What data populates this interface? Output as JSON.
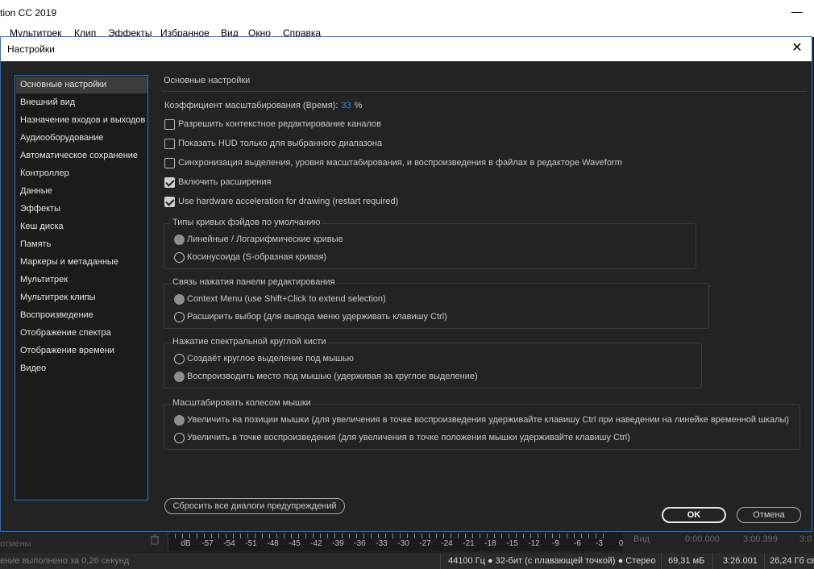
{
  "app": {
    "title": "tion CC 2019",
    "minimize_glyph": "—",
    "menu": [
      "Мультитрек",
      "Клип",
      "Эффекты",
      "Избранное",
      "Вид",
      "Окно",
      "Справка"
    ]
  },
  "dialog": {
    "title": "Настройки",
    "close_glyph": "✕",
    "sidebar": [
      "Основные настройки",
      "Внешний вид",
      "Назначение входов и выходов",
      "Аудиооборудование",
      "Автоматическое сохранение",
      "Контроллер",
      "Данные",
      "Эффекты",
      "Кеш диска",
      "Память",
      "Маркеры и метаданные",
      "Мультитрек",
      "Мультитрек клипы",
      "Воспроизведение",
      "Отображение спектра",
      "Отображение времени",
      "Видео"
    ],
    "active_sidebar_index": 0,
    "section_title": "Основные настройки",
    "zoom_label": "Коэффициент масштабирования (Время):",
    "zoom_value": "33",
    "zoom_unit": "%",
    "checkboxes": [
      {
        "label": "Разрешить контекстное редактирование каналов",
        "checked": false
      },
      {
        "label": "Показать HUD только для выбранного диапазона",
        "checked": false
      },
      {
        "label": "Синхронизация выделения, уровня масштабирования, и воспроизведения в файлах в редакторе Waveform",
        "checked": false
      },
      {
        "label": "Включить расширения",
        "checked": true
      },
      {
        "label": "Use hardware acceleration for drawing (restart required)",
        "checked": true
      }
    ],
    "groups": [
      {
        "title": "Типы кривых фэйдов по умолчанию",
        "options": [
          {
            "label": "Линейные / Логарифмические кривые",
            "selected": true
          },
          {
            "label": "Косинусоида (S-образная кривая)",
            "selected": false
          }
        ]
      },
      {
        "title": "Связь нажатия панели редактирования",
        "options": [
          {
            "label": "Context Menu (use Shift+Click to extend selection)",
            "selected": true
          },
          {
            "label": "Расширить выбор (для вывода меню удерживать клавишу Ctrl)",
            "selected": false
          }
        ]
      },
      {
        "title": "Нажатие спектральной круглой кисти",
        "options": [
          {
            "label": "Создаёт круглое выделение под мышью",
            "selected": false
          },
          {
            "label": "Воспроизводить место под мышью (удерживая за круглое выделение)",
            "selected": true
          }
        ]
      },
      {
        "title": "Масштабировать колесом мышки",
        "options": [
          {
            "label": "Увеличить на позиции мышки (для увеличения в точке воспроизведения удерживайте клавишу Ctrl при наведении на линейке временной шкалы)",
            "selected": true
          },
          {
            "label": "Увеличить в точке воспроизведения (для увеличения в точке положения мышки удерживайте клавишу Ctrl)",
            "selected": false
          }
        ]
      }
    ],
    "reset_label": "Сбросить все диалоги предупреждений",
    "ok_label": "OK",
    "cancel_label": "Отмена"
  },
  "bottom": {
    "left_label": "отмены",
    "meter_labels": [
      "dB",
      "-57",
      "-54",
      "-51",
      "-48",
      "-45",
      "-42",
      "-39",
      "-36",
      "-33",
      "-30",
      "-27",
      "-24",
      "-21",
      "-18",
      "-15",
      "-12",
      "-9",
      "-6",
      "-3",
      "0"
    ],
    "view_label": "Вид",
    "time_start": "0:00.000",
    "time_end": "3:00.399",
    "time_extra": "3:0",
    "status_left": "ение выполнено за 0,26 секунд",
    "status_format": "44100 Гц ● 32-бит (с плавающей точкой) ● Стерео",
    "status_size": "69,31 мБ",
    "status_duration": "3:26.001",
    "status_free": "26,24 Гб св"
  },
  "colors": {
    "accent": "#1473e6",
    "zoom_value": "#2d8ceb",
    "panel_bg": "#232323"
  }
}
